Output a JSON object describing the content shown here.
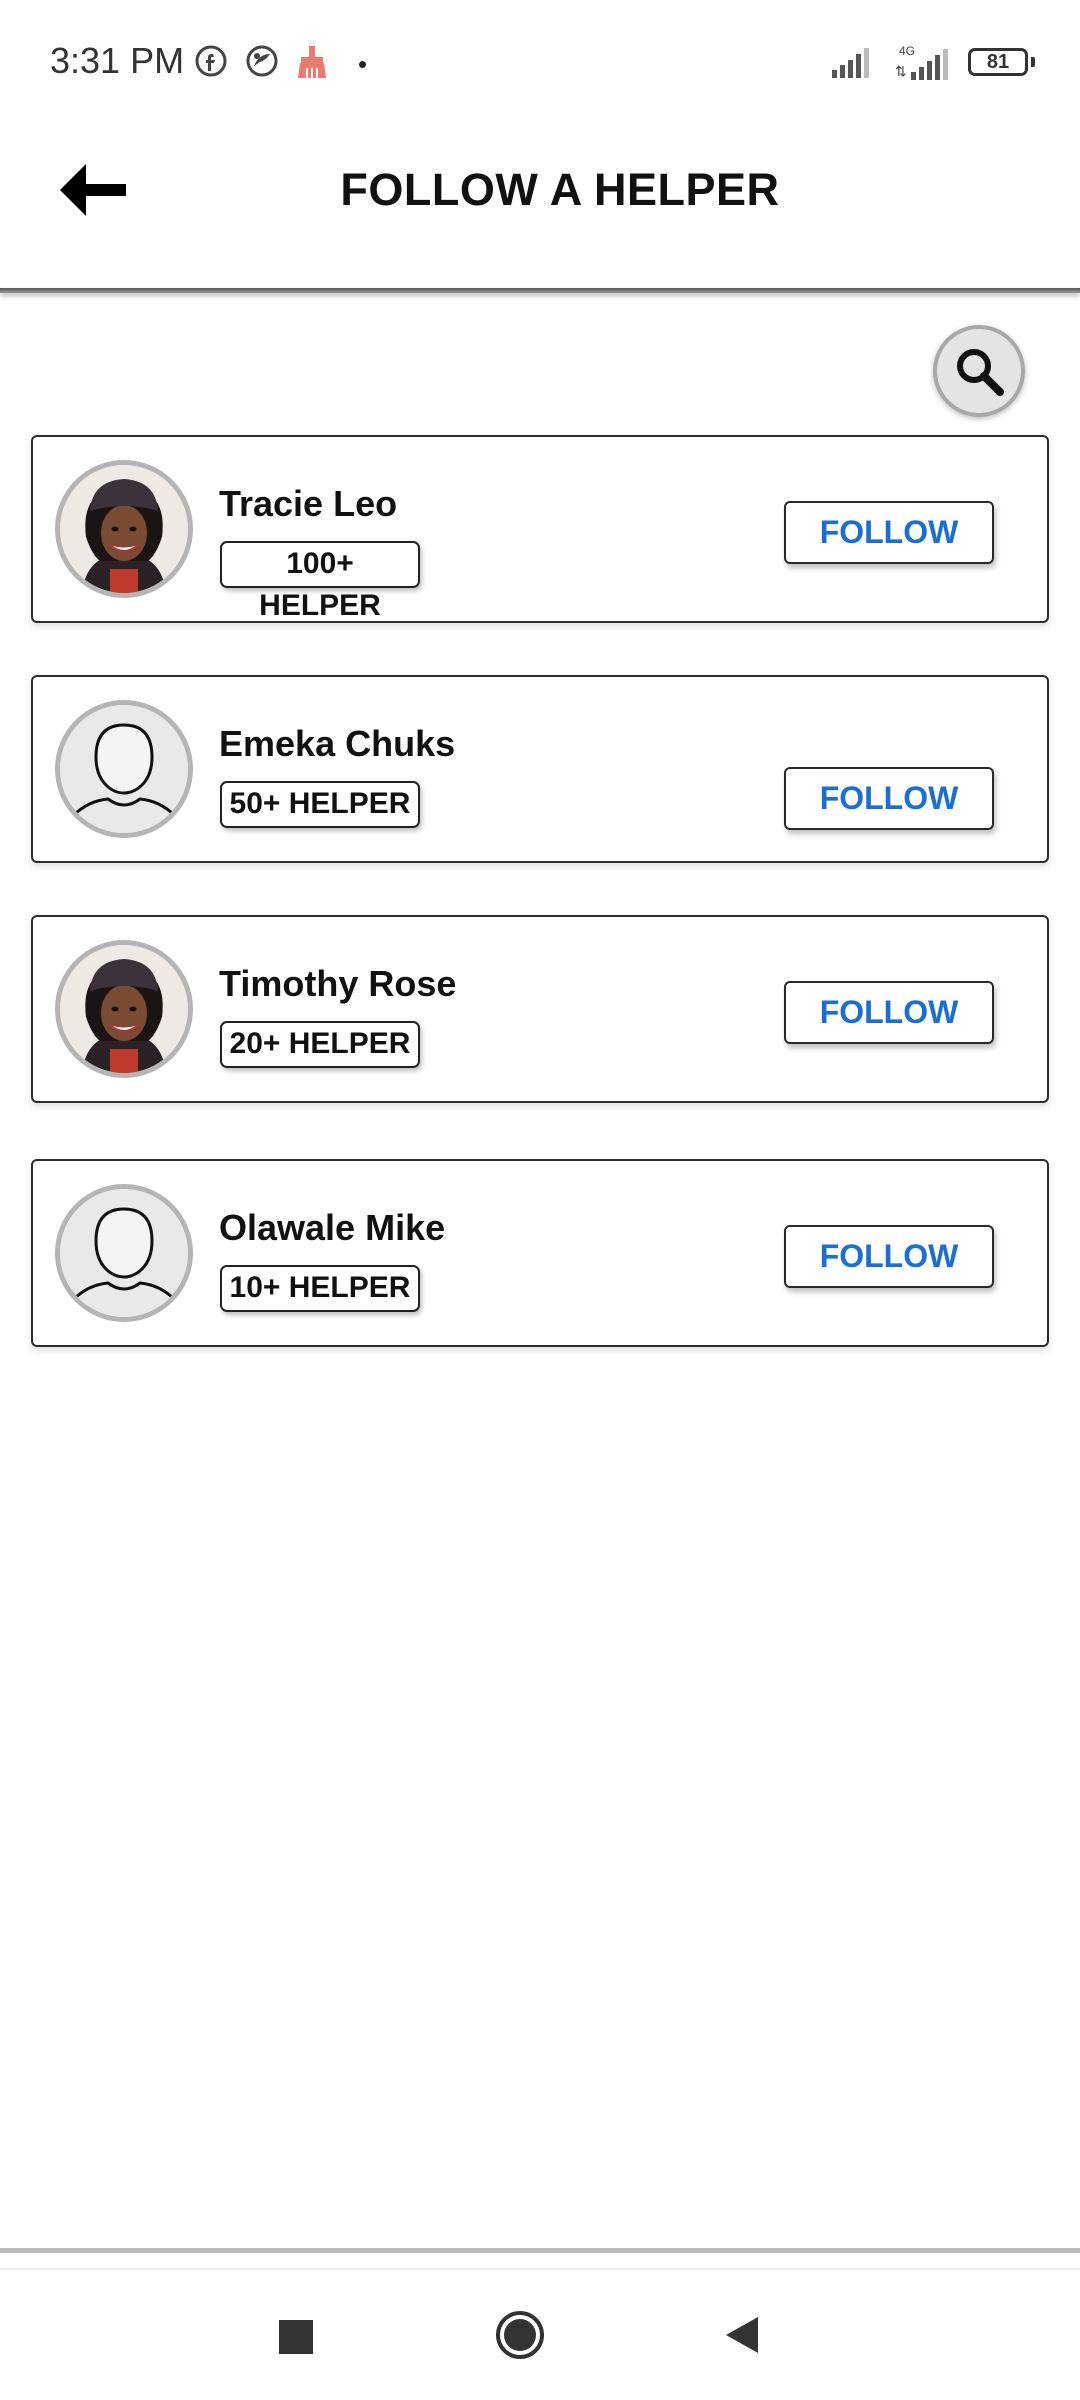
{
  "status_bar": {
    "time": "3:31 PM",
    "battery": "81",
    "network": "4G",
    "icons": [
      "facebook-icon",
      "browser-icon",
      "cleaner-icon",
      "signal-icon",
      "signal-4g-icon",
      "battery-icon"
    ]
  },
  "header": {
    "title": "FOLLOW A HELPER",
    "back_icon": "arrow-left-icon"
  },
  "search": {
    "icon": "search-icon"
  },
  "helpers": [
    {
      "name": "Tracie Leo",
      "badge": "100+ HELPER",
      "follow_label": "FOLLOW",
      "avatar": "photo"
    },
    {
      "name": "Emeka Chuks",
      "badge": "50+ HELPER",
      "follow_label": "FOLLOW",
      "avatar": "placeholder"
    },
    {
      "name": "Timothy Rose",
      "badge": "20+ HELPER",
      "follow_label": "FOLLOW",
      "avatar": "photo"
    },
    {
      "name": "Olawale Mike",
      "badge": "10+ HELPER",
      "follow_label": "FOLLOW",
      "avatar": "placeholder"
    }
  ],
  "nav": {
    "recents_icon": "square-icon",
    "home_icon": "circle-icon",
    "back_icon": "triangle-back-icon"
  },
  "colors": {
    "follow_text": "#1a6fd6",
    "title_text": "#111111",
    "card_border": "#2d2d2d"
  }
}
